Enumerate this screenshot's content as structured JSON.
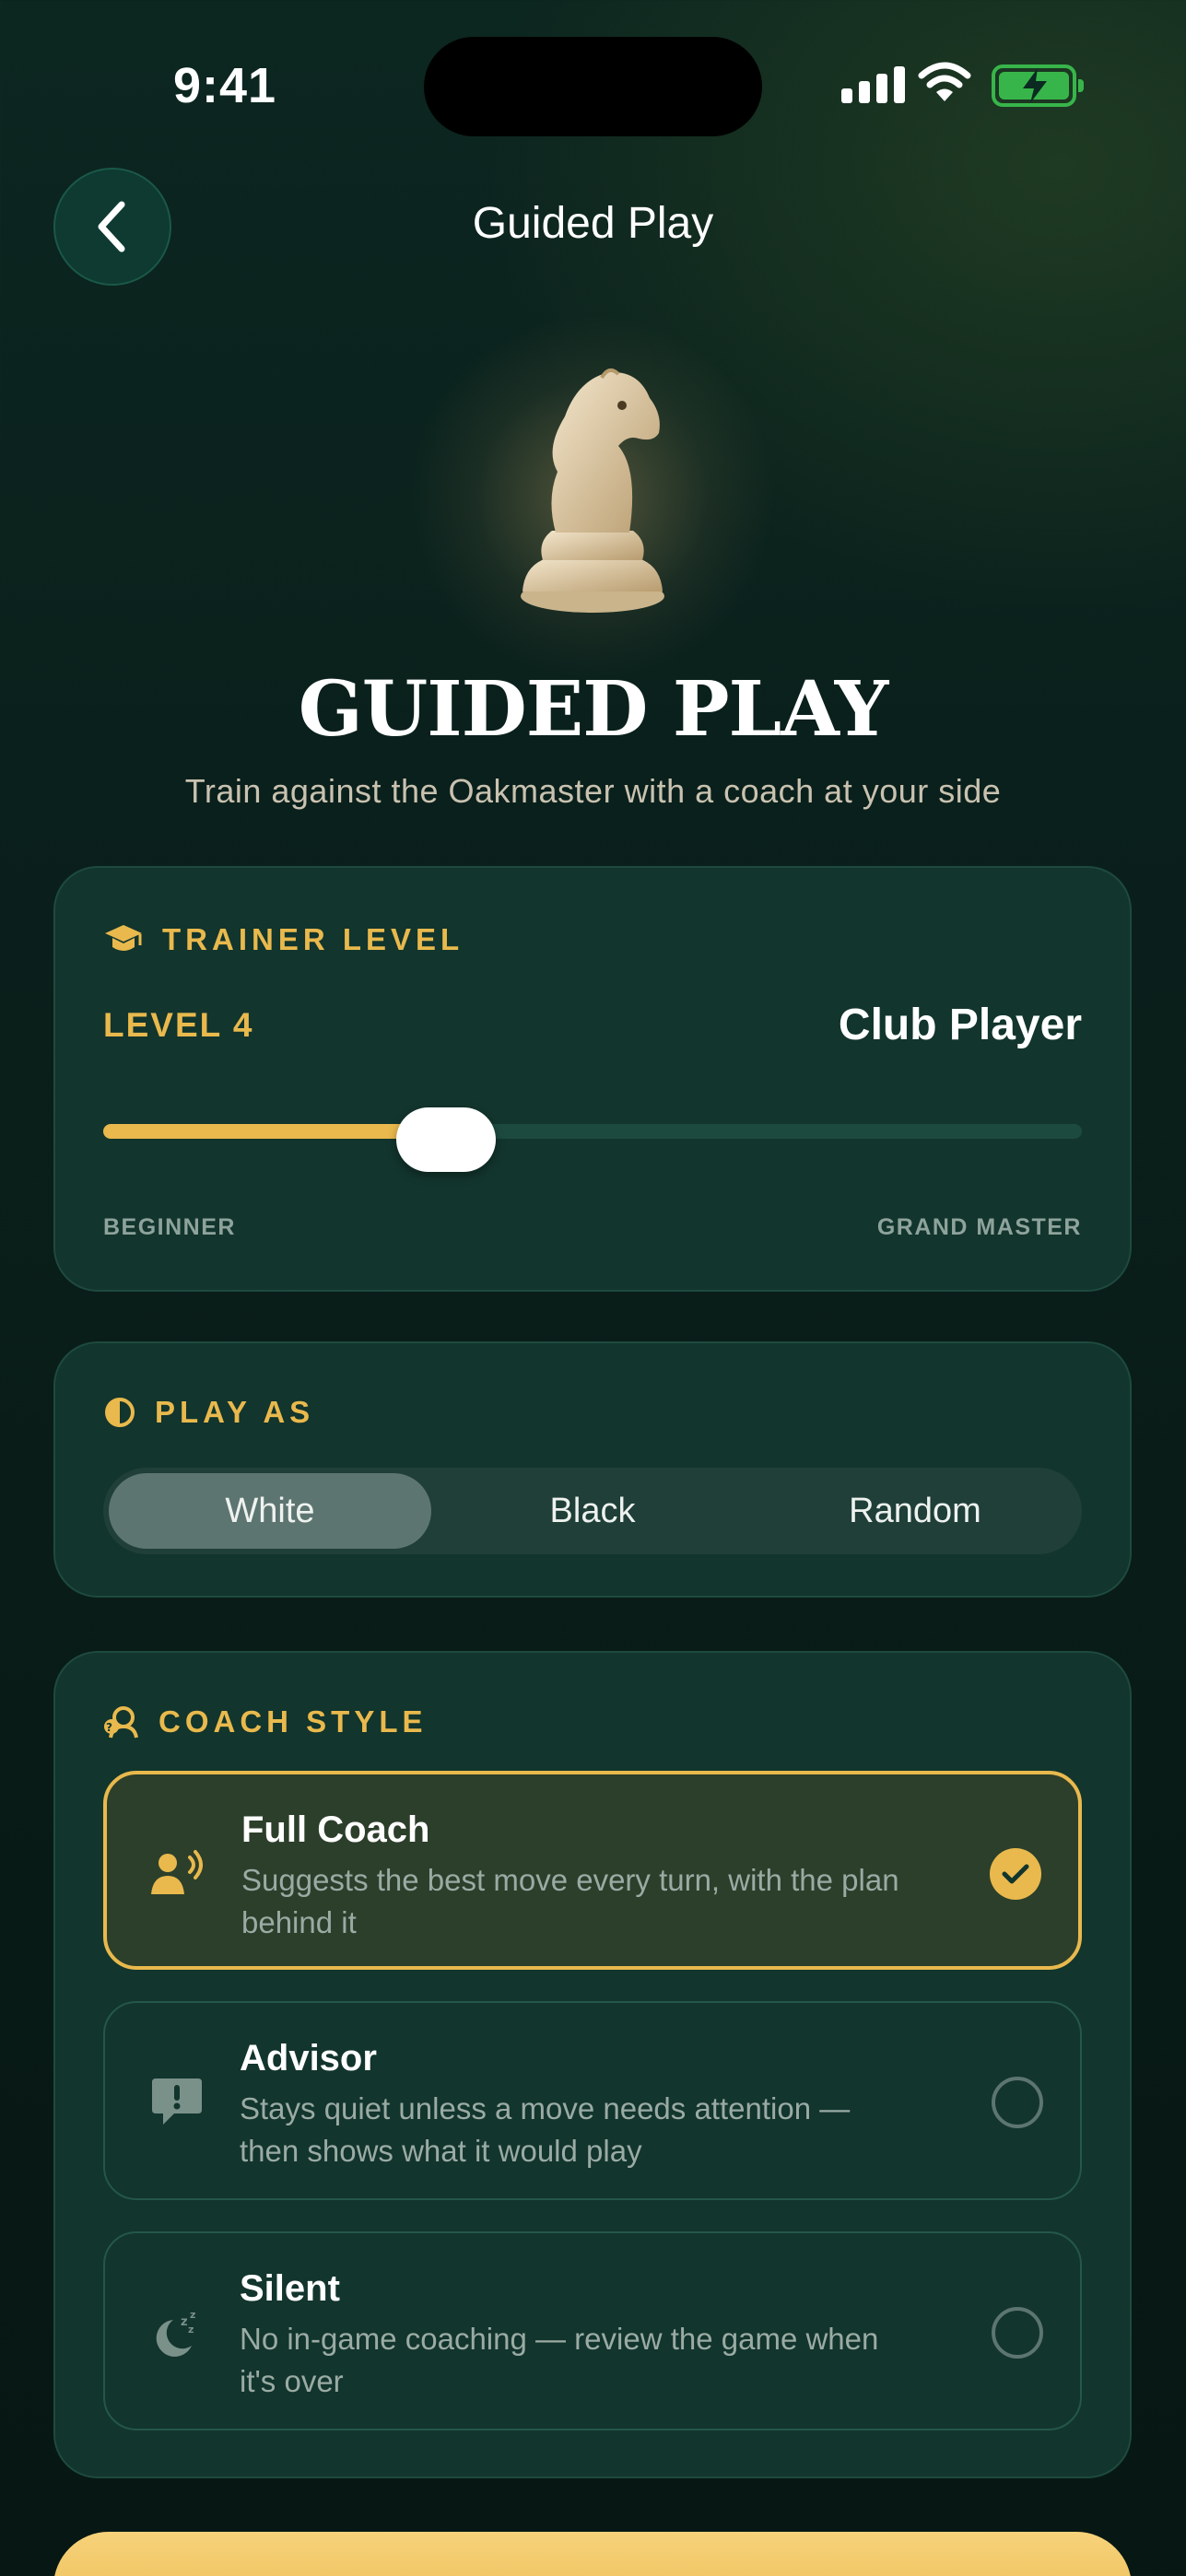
{
  "status_bar": {
    "time": "9:41"
  },
  "header": {
    "title": "Guided Play"
  },
  "hero": {
    "title": "GUIDED PLAY",
    "subtitle": "Train against the Oakmaster with a coach at your side"
  },
  "trainer_level": {
    "heading": "TRAINER LEVEL",
    "level_label": "LEVEL 4",
    "level_name": "Club Player",
    "progress_fraction": 0.35,
    "min_label": "BEGINNER",
    "max_label": "GRAND MASTER"
  },
  "play_as": {
    "heading": "PLAY AS",
    "options": [
      "White",
      "Black",
      "Random"
    ],
    "selected": "White"
  },
  "coach_style": {
    "heading": "COACH STYLE",
    "options": [
      {
        "title": "Full Coach",
        "description": "Suggests the best move every turn, with the plan behind it",
        "icon": "speaking-person-icon",
        "selected": true
      },
      {
        "title": "Advisor",
        "description": "Stays quiet unless a move needs attention — then shows what it would play",
        "icon": "alert-bubble-icon",
        "selected": false
      },
      {
        "title": "Silent",
        "description": "No in-game coaching — review the game when it's over",
        "icon": "moon-sleep-icon",
        "selected": false
      }
    ]
  },
  "colors": {
    "accent": "#e9b94d",
    "card": "#12352d",
    "background": "#0a1f1b"
  }
}
